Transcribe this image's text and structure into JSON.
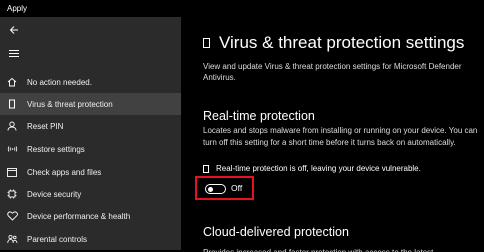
{
  "app": {
    "title": "Apply"
  },
  "sidebar": {
    "items": [
      {
        "label": "No action needed.",
        "icon": "home-icon",
        "selected": false
      },
      {
        "label": "Virus & threat protection",
        "icon": "shield-icon",
        "selected": true
      },
      {
        "label": "Reset PIN",
        "icon": "person-icon",
        "selected": false
      },
      {
        "label": "Restore settings",
        "icon": "wireless-icon",
        "selected": false
      },
      {
        "label": "Check apps and files",
        "icon": "window-icon",
        "selected": false
      },
      {
        "label": "Device security",
        "icon": "chip-icon",
        "selected": false
      },
      {
        "label": "Device performance & health",
        "icon": "heart-icon",
        "selected": false
      },
      {
        "label": "Parental controls",
        "icon": "family-icon",
        "selected": false
      }
    ]
  },
  "main": {
    "title": "Virus & threat protection settings",
    "subtitle": "View and update Virus & threat protection settings for Microsoft Defender Antivirus.",
    "realtime": {
      "heading": "Real-time protection",
      "description": "Locates and stops malware from installing or running on your device. You can turn off this setting for a short time before it turns back on automatically.",
      "warning": "Real-time protection is off, leaving your device vulnerable.",
      "toggle_label": "Off",
      "toggle_on": false,
      "highlight_color": "#e81123"
    },
    "cloud": {
      "heading": "Cloud-delivered protection",
      "description": "Provides increased and faster protection with access to the latest"
    }
  }
}
